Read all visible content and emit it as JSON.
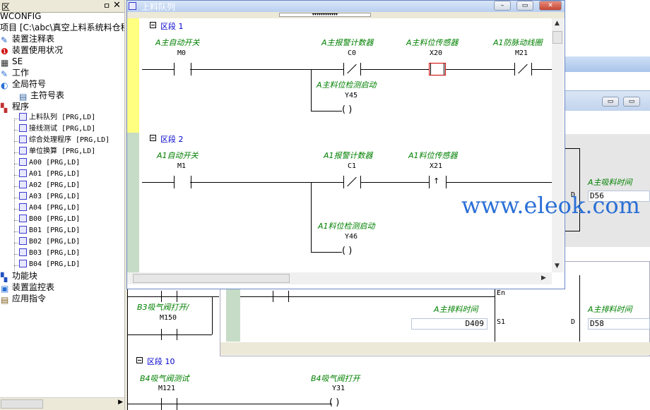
{
  "tree": {
    "title": "区",
    "pin": "ㅁ",
    "close": "✕",
    "items": [
      {
        "label": "WCONFIG",
        "icon": ""
      },
      {
        "label": "项目 [C:\\abc\\真空上料系统料仓程",
        "icon": ""
      },
      {
        "label": "装置注释表",
        "icon": "pencil-table-icon"
      },
      {
        "label": "装置使用状况",
        "icon": "warning-circle-icon"
      },
      {
        "label": "SE",
        "icon": "grid-icon"
      },
      {
        "label": "工作",
        "icon": "wrench-icon"
      },
      {
        "label": "全局符号",
        "icon": "globe-icon"
      },
      {
        "label": "主符号表",
        "icon": "table-icon"
      },
      {
        "label": "程序",
        "icon": "program-icon"
      },
      {
        "label": "上料队列 [PRG,LD]",
        "icon": "ladder-doc-icon"
      },
      {
        "label": "接线测试 [PRG,LD]",
        "icon": "ladder-doc-icon"
      },
      {
        "label": "综合处理程序 [PRG,LD]",
        "icon": "ladder-doc-icon"
      },
      {
        "label": "单位换算 [PRG,LD]",
        "icon": "ladder-doc-icon"
      },
      {
        "label": "A00 [PRG,LD]",
        "icon": "ladder-doc-icon"
      },
      {
        "label": "A01 [PRG,LD]",
        "icon": "ladder-doc-icon"
      },
      {
        "label": "A02 [PRG,LD]",
        "icon": "ladder-doc-icon"
      },
      {
        "label": "A03 [PRG,LD]",
        "icon": "ladder-doc-icon"
      },
      {
        "label": "A04 [PRG,LD]",
        "icon": "ladder-doc-icon"
      },
      {
        "label": "B00 [PRG,LD]",
        "icon": "ladder-doc-icon"
      },
      {
        "label": "B01 [PRG,LD]",
        "icon": "ladder-doc-icon"
      },
      {
        "label": "B02 [PRG,LD]",
        "icon": "ladder-doc-icon"
      },
      {
        "label": "B03 [PRG,LD]",
        "icon": "ladder-doc-icon"
      },
      {
        "label": "B04 [PRG,LD]",
        "icon": "ladder-doc-icon"
      },
      {
        "label": "功能块",
        "icon": "function-block-icon"
      },
      {
        "label": "装置监控表",
        "icon": "monitor-icon"
      },
      {
        "label": "应用指令",
        "icon": "book-icon"
      }
    ]
  },
  "window": {
    "title": "上料队列",
    "minimize": "–",
    "restore": "▭",
    "close": "✕",
    "split": "▾▾▾▾▾▾▾▾▾▾▾▾"
  },
  "segment1": {
    "name": "区段 1",
    "contacts": [
      {
        "comment": "A主自动开关",
        "device": "M0"
      },
      {
        "comment": "A主报警计数器",
        "device": "C0"
      },
      {
        "comment": "A主料位传感器",
        "device": "X20"
      },
      {
        "comment": "A1防脉动线圈",
        "device": "M21"
      }
    ],
    "coil": {
      "comment": "A主料位检测启动",
      "device": "Y45",
      "symbol": "(   )"
    }
  },
  "segment2": {
    "name": "区段 2",
    "contacts": [
      {
        "comment": "A1自动开关",
        "device": "M1"
      },
      {
        "comment": "A1报警计数器",
        "device": "C1"
      },
      {
        "comment": "A1料位传感器",
        "device": "X21"
      }
    ],
    "coil": {
      "comment": "A1料位检测启动",
      "device": "Y46",
      "symbol": "(   )"
    }
  },
  "background": {
    "right_comment": "A主吸料时间",
    "right_field": "D56",
    "right_d": "D",
    "lower_comment_left": "A主排料时间",
    "lower_field_left": "D409",
    "lower_s1": "S1",
    "lower_en": "En",
    "lower_d": "D",
    "lower_comment_right": "A主排料时间",
    "lower_field_right": "D58",
    "b3_comment": "B3吸气阀打开/",
    "b3_device": "M150",
    "segment10": "区段 10",
    "b4_test_comment": "B4吸气阀测试",
    "b4_test_device": "M121",
    "b4_open_comment": "B4吸气阀打开",
    "b4_open_device": "Y31",
    "b4_coil": "(   )",
    "win2_button": "▭"
  },
  "watermark": "www.eleok.com"
}
